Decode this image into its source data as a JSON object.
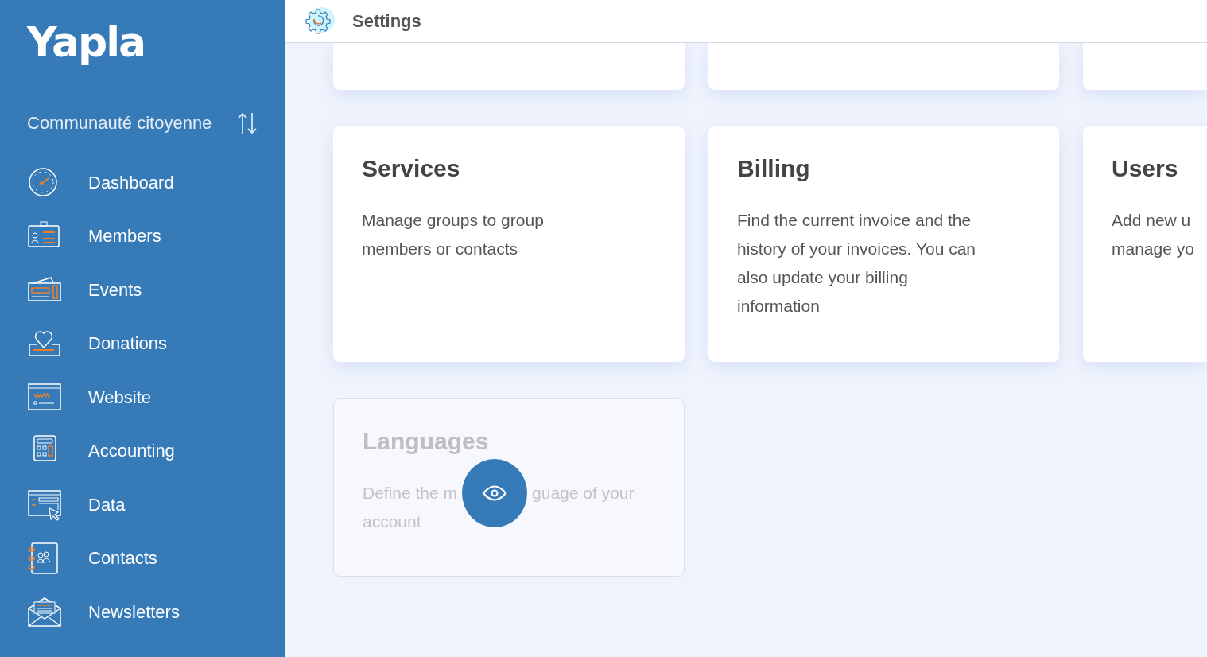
{
  "sidebar": {
    "logo": "Yapla",
    "organization": "Communauté citoyenne",
    "items": [
      {
        "label": "Dashboard"
      },
      {
        "label": "Members"
      },
      {
        "label": "Events"
      },
      {
        "label": "Donations"
      },
      {
        "label": "Website"
      },
      {
        "label": "Accounting"
      },
      {
        "label": "Data"
      },
      {
        "label": "Contacts"
      },
      {
        "label": "Newsletters"
      }
    ]
  },
  "header": {
    "title": "Settings"
  },
  "cards": [
    {
      "kind": "stub"
    },
    {
      "kind": "stub"
    },
    {
      "kind": "stub"
    },
    {
      "kind": "card",
      "title": "Services",
      "lines": [
        "Manage groups to group",
        "members or contacts"
      ],
      "disabled": false
    },
    {
      "kind": "card",
      "title": "Billing",
      "lines": [
        "Find the current invoice and the",
        "history of your invoices. You can",
        "also update your billing",
        "information"
      ],
      "disabled": false
    },
    {
      "kind": "edge",
      "title": "Users",
      "lines": [
        "Add new u",
        "manage yo"
      ],
      "disabled": false
    },
    {
      "kind": "hover",
      "title": "Languages",
      "parts": [
        "Define the m",
        "guage of your"
      ],
      "lines": [
        "account"
      ],
      "disabled": true
    }
  ]
}
